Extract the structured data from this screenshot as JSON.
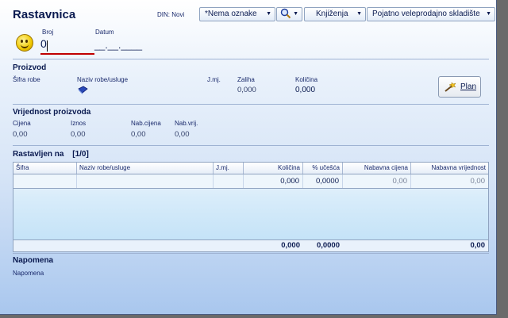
{
  "header": {
    "title": "Rastavnica",
    "din_label": "DIN: Novi",
    "buttons": {
      "oznake": "*Nema oznake",
      "knjizenja": "Knjiženja",
      "skladiste": "Pojatno veleprodajno skladište"
    },
    "broj_label": "Broj",
    "broj_value": "0",
    "datum_label": "Datum",
    "datum_value": "__.__.____"
  },
  "proizvod": {
    "title": "Proizvod",
    "sifra_label": "Šifra robe",
    "naziv_label": "Naziv robe/usluge",
    "jmj_label": "J.mj.",
    "zaliha_label": "Zaliha",
    "zaliha_value": "0,000",
    "kolicina_label": "Količina",
    "kolicina_value": "0,000",
    "plan_label": "Plan"
  },
  "vrijednost": {
    "title": "Vrijednost proizvoda",
    "fields": [
      {
        "label": "Cijena",
        "value": "0,00"
      },
      {
        "label": "Iznos",
        "value": "0,00"
      },
      {
        "label": "Nab.cijena",
        "value": "0,00"
      },
      {
        "label": "Nab.vrij.",
        "value": "0,00"
      }
    ]
  },
  "rastavljen": {
    "title": "Rastavljen na",
    "count": "[1/0]",
    "columns": [
      "Šifra",
      "Naziv robe/usluge",
      "J.mj.",
      "Količina",
      "% učešća",
      "Nabavna cijena",
      "Nabavna vrijednost"
    ],
    "row": [
      "",
      "",
      "",
      "0,000",
      "0,0000",
      "0,00",
      "0,00"
    ],
    "totals": {
      "kolicina": "0,000",
      "ucesce": "0,0000",
      "vrijednost": "0,00"
    }
  },
  "napomena": {
    "title": "Napomena",
    "label": "Napomena"
  },
  "colors": {
    "accent": "#0a1a50",
    "broj_underline": "#c00000",
    "grid_fill": "#bfe0f7"
  },
  "icons": [
    "smiley-icon",
    "search-icon",
    "book-icon",
    "wand-icon"
  ]
}
